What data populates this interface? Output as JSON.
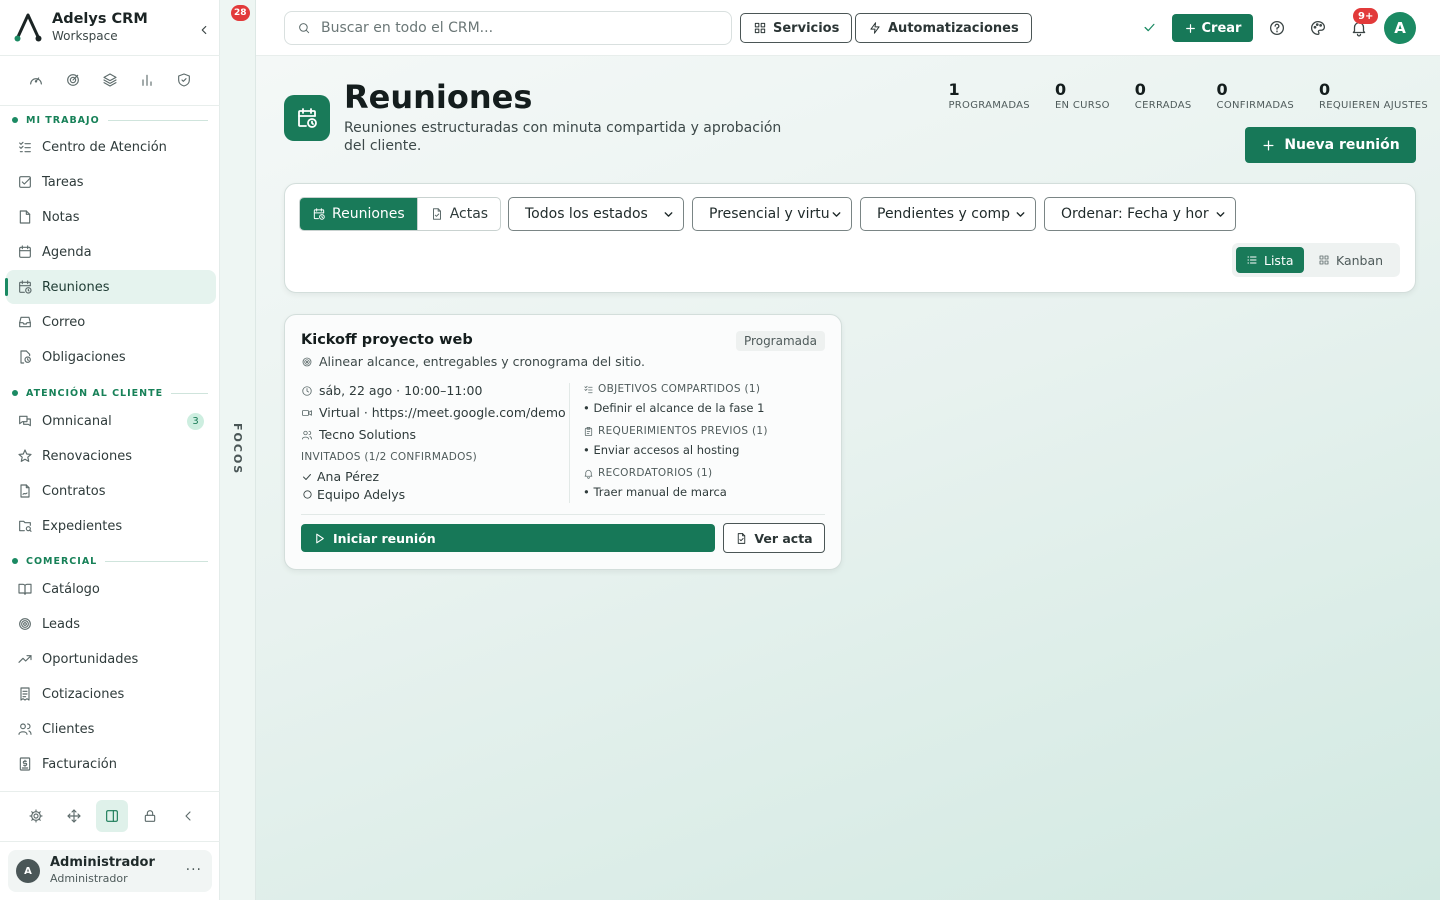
{
  "brand": {
    "name": "Adelys CRM",
    "workspace": "Workspace"
  },
  "sidebar": {
    "quick_icons": [
      "gauge-icon",
      "target-icon",
      "layers-icon",
      "bar-chart-icon",
      "shield-check-icon"
    ],
    "sections": [
      {
        "title": "MI TRABAJO"
      },
      {
        "title": "ATENCIÓN AL CLIENTE"
      },
      {
        "title": "COMERCIAL"
      }
    ],
    "items": [
      {
        "label": "Centro de Atención",
        "icon": "list-check-icon"
      },
      {
        "label": "Tareas",
        "icon": "checkbox-icon"
      },
      {
        "label": "Notas",
        "icon": "note-icon"
      },
      {
        "label": "Agenda",
        "icon": "calendar-icon"
      },
      {
        "label": "Reuniones",
        "icon": "calendar-clock-icon",
        "active": true
      },
      {
        "label": "Correo",
        "icon": "inbox-icon"
      },
      {
        "label": "Obligaciones",
        "icon": "file-clock-icon"
      },
      {
        "label": "Omnicanal",
        "icon": "chat-icon",
        "badge": "3"
      },
      {
        "label": "Renovaciones",
        "icon": "star-icon"
      },
      {
        "label": "Contratos",
        "icon": "file-signature-icon"
      },
      {
        "label": "Expedientes",
        "icon": "folder-search-icon"
      },
      {
        "label": "Catálogo",
        "icon": "book-open-icon"
      },
      {
        "label": "Leads",
        "icon": "target-icon"
      },
      {
        "label": "Oportunidades",
        "icon": "trending-up-icon"
      },
      {
        "label": "Cotizaciones",
        "icon": "receipt-icon"
      },
      {
        "label": "Clientes",
        "icon": "users-icon"
      },
      {
        "label": "Facturación",
        "icon": "dollar-file-icon"
      }
    ],
    "tools": [
      "gear-icon",
      "move-icon",
      "panel-icon",
      "lock-icon",
      "chevron-left-icon"
    ],
    "user": {
      "initial": "A",
      "name": "Administrador",
      "role": "Administrador",
      "more": "···"
    }
  },
  "focos": {
    "badge": "28",
    "label": "FOCOS"
  },
  "topbar": {
    "search_placeholder": "Buscar en todo el CRM...",
    "services_label": "Servicios",
    "automations_label": "Automatizaciones",
    "create_label": "Crear",
    "notif_badge": "9+",
    "avatar_initial": "A"
  },
  "page": {
    "title": "Reuniones",
    "subtitle": "Reuniones estructuradas con minuta compartida y aprobación del cliente.",
    "stats": [
      {
        "value": "1",
        "label": "PROGRAMADAS"
      },
      {
        "value": "0",
        "label": "EN CURSO"
      },
      {
        "value": "0",
        "label": "CERRADAS"
      },
      {
        "value": "0",
        "label": "CONFIRMADAS"
      },
      {
        "value": "0",
        "label": "REQUIEREN AJUSTES"
      }
    ],
    "new_button": "Nueva reunión"
  },
  "filters": {
    "tabs": [
      {
        "label": "Reuniones",
        "active": true
      },
      {
        "label": "Actas",
        "active": false
      }
    ],
    "status_select": "Todos los estados",
    "mode_select": "Presencial y virtu",
    "pending_select": "Pendientes y comp",
    "order_select": "Ordenar: Fecha y hor",
    "view": [
      {
        "label": "Lista",
        "active": true
      },
      {
        "label": "Kanban",
        "active": false
      }
    ]
  },
  "meetings": [
    {
      "title": "Kickoff proyecto web",
      "status": "Programada",
      "goal": "Alinear alcance, entregables y cronograma del sitio.",
      "datetime": "sáb, 22 ago · 10:00–11:00",
      "location": "Virtual · https://meet.google.com/demo",
      "client": "Tecno Solutions",
      "invitees_header": "INVITADOS (1/2 CONFIRMADOS)",
      "invitees": [
        {
          "name": "Ana Pérez",
          "confirmed": true
        },
        {
          "name": "Equipo Adelys",
          "confirmed": false
        }
      ],
      "objectives_header": "OBJETIVOS COMPARTIDOS (1)",
      "objectives": [
        "• Definir el alcance de la fase 1"
      ],
      "requirements_header": "REQUERIMIENTOS PREVIOS (1)",
      "requirements": [
        "• Enviar accesos al hosting"
      ],
      "reminders_header": "RECORDATORIOS (1)",
      "reminders": [
        "• Traer manual de marca"
      ],
      "start_label": "Iniciar reunión",
      "acta_label": "Ver acta"
    }
  ]
}
